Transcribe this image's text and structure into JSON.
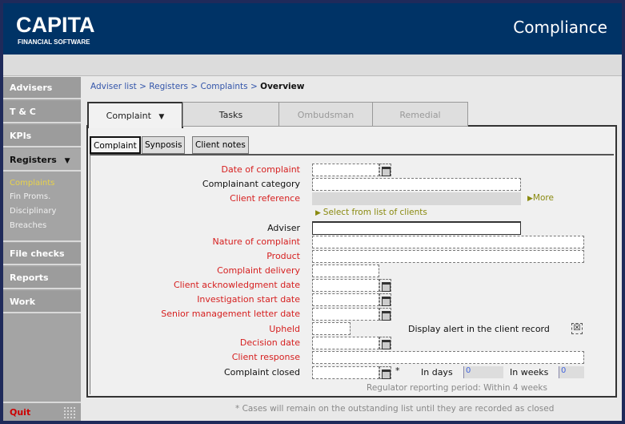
{
  "header": {
    "logo": "CAPITA",
    "logo_sub": "FINANCIAL SOFTWARE",
    "app_title": "Compliance"
  },
  "sidebar": {
    "items": [
      {
        "label": "Advisers"
      },
      {
        "label": "T & C"
      },
      {
        "label": "KPIs"
      },
      {
        "label": "Registers"
      },
      {
        "label": "File checks"
      },
      {
        "label": "Reports"
      },
      {
        "label": "Work"
      }
    ],
    "sub_items": [
      {
        "label": "Complaints"
      },
      {
        "label": "Fin Proms."
      },
      {
        "label": "Disciplinary"
      },
      {
        "label": "Breaches"
      }
    ],
    "quit": "Quit"
  },
  "breadcrumb": {
    "items": [
      "Adviser list",
      "Registers",
      "Complaints"
    ],
    "sep": " > ",
    "current": "Overview"
  },
  "tabs": [
    {
      "label": "Complaint"
    },
    {
      "label": "Tasks"
    },
    {
      "label": "Ombudsman"
    },
    {
      "label": "Remedial"
    }
  ],
  "subtabs": [
    {
      "label": "Complaint"
    },
    {
      "label": "Synposis"
    },
    {
      "label": "Client notes"
    }
  ],
  "form": {
    "labels": {
      "date_of_complaint": "Date of complaint",
      "complainant_category": "Complainant category",
      "client_reference": "Client reference",
      "adviser": "Adviser",
      "nature": "Nature of complaint",
      "product": "Product",
      "delivery": "Complaint delivery",
      "ack_date": "Client acknowledgment date",
      "investigation_date": "Investigation start date",
      "senior_letter_date": "Senior management letter date",
      "upheld": "Upheld",
      "decision_date": "Decision date",
      "client_response": "Client response",
      "complaint_closed": "Complaint closed"
    },
    "more_link": "More",
    "select_clients_link": "Select from list of clients",
    "display_alert": "Display alert in the client record",
    "display_alert_checked": true,
    "asterisk": "*",
    "in_days_label": "In days",
    "in_days": "0",
    "in_weeks_label": "In weeks",
    "in_weeks": "0",
    "regulator_note": "Regulator reporting period: Within 4 weeks"
  },
  "footer_note": "* Cases will remain on the outstanding list until they are recorded as closed",
  "colors": {
    "header": "#003366",
    "required": "#d62020",
    "active_sub": "#e8d24a"
  }
}
